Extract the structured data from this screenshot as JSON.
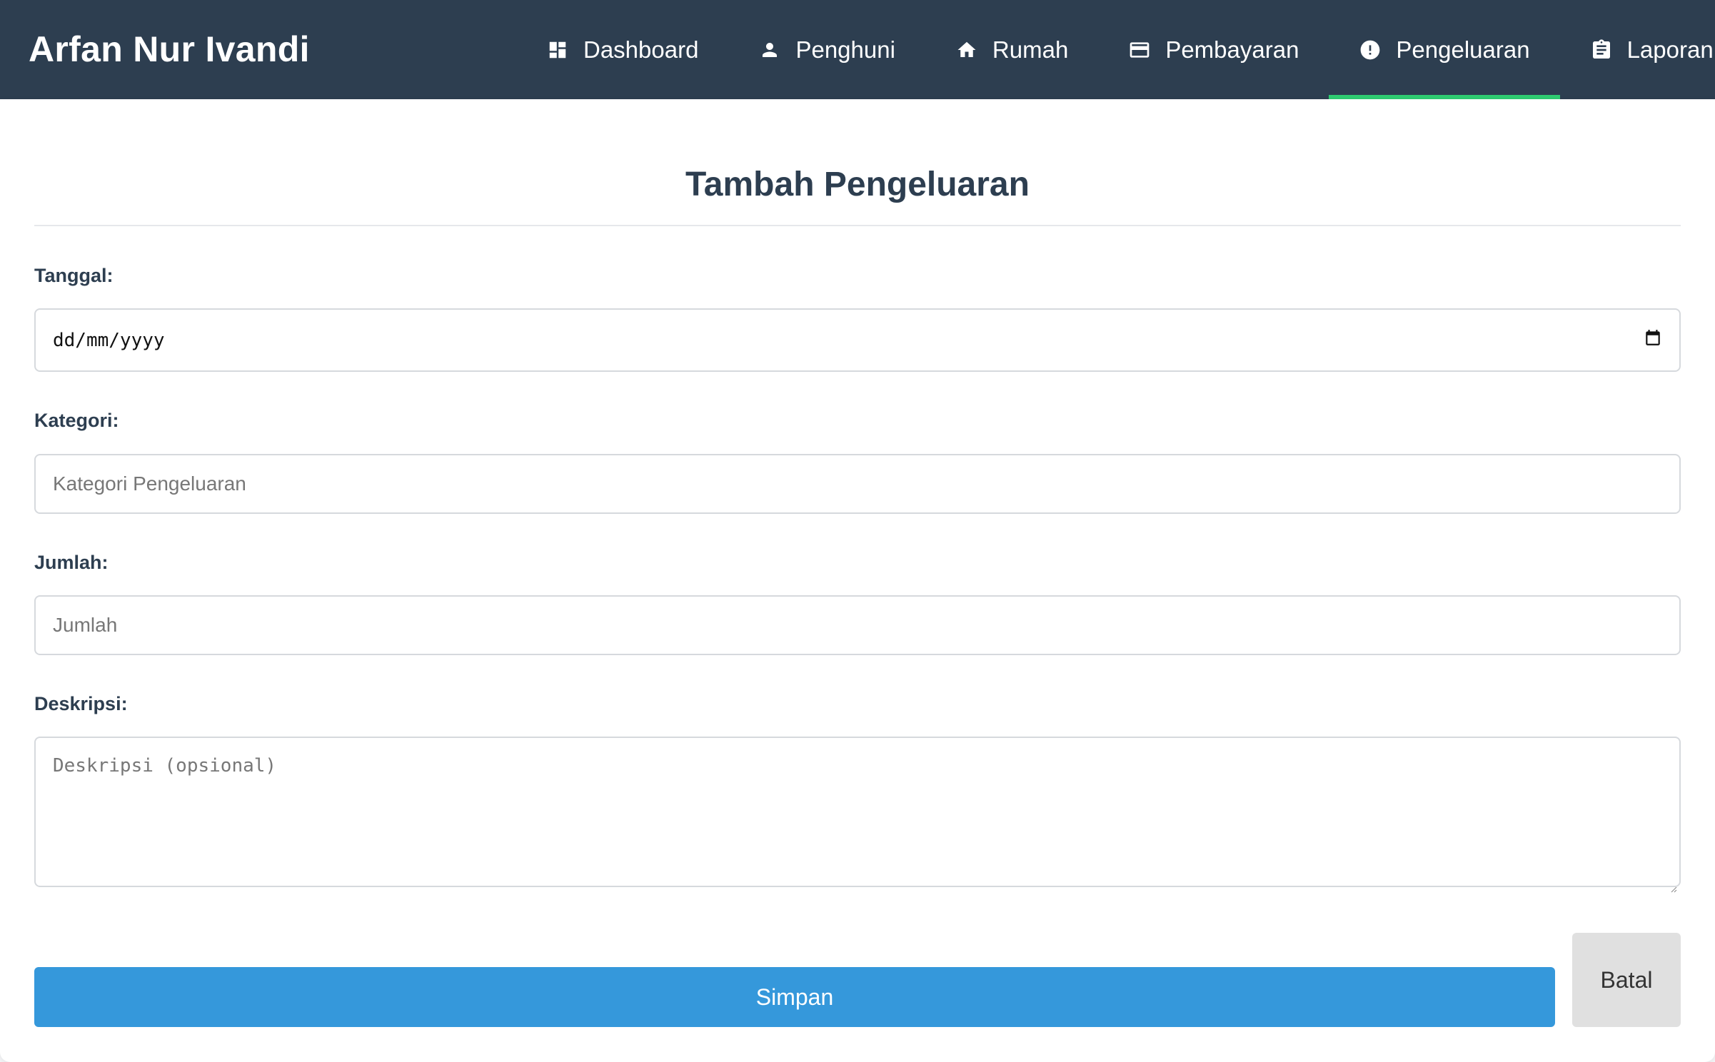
{
  "app": {
    "brand": "Arfan Nur Ivandi"
  },
  "nav": {
    "items": [
      {
        "label": "Dashboard",
        "icon": "dashboard-icon"
      },
      {
        "label": "Penghuni",
        "icon": "person-icon"
      },
      {
        "label": "Rumah",
        "icon": "home-icon"
      },
      {
        "label": "Pembayaran",
        "icon": "credit-card-icon"
      },
      {
        "label": "Pengeluaran",
        "icon": "alert-circle-icon",
        "active": true
      },
      {
        "label": "Laporan",
        "icon": "clipboard-icon"
      }
    ],
    "active_color": "#2ecc71"
  },
  "form": {
    "title": "Tambah Pengeluaran",
    "tanggal": {
      "label": "Tanggal:",
      "placeholder": "dd/mm/yyyy",
      "icon": "calendar-icon"
    },
    "kategori": {
      "label": "Kategori:",
      "placeholder": "Kategori Pengeluaran"
    },
    "jumlah": {
      "label": "Jumlah:",
      "placeholder": "Jumlah"
    },
    "deskripsi": {
      "label": "Deskripsi:",
      "placeholder": "Deskripsi (opsional)"
    },
    "save_label": "Simpan",
    "cancel_label": "Batal"
  },
  "colors": {
    "navbar_bg": "#2d3e50",
    "primary": "#3598db",
    "secondary_button": "#e0e0e0",
    "accent": "#2ecc71"
  }
}
